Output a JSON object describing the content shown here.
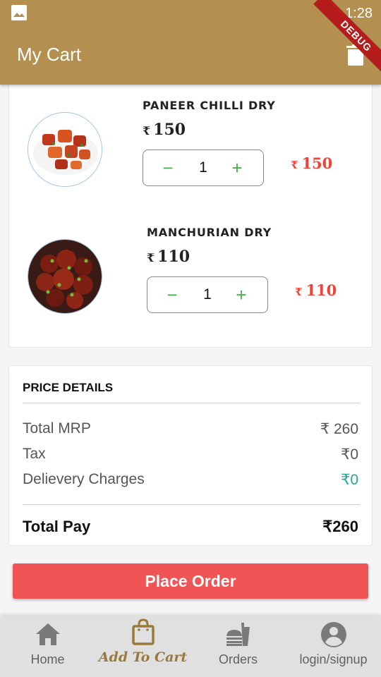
{
  "status_bar": {
    "time": "1:28"
  },
  "app_bar": {
    "title": "My Cart",
    "debug_label": "DEBUG"
  },
  "cart": {
    "currency": "₹",
    "items": [
      {
        "name": "PANEER CHILLI DRY",
        "price": "150",
        "quantity": "1",
        "total": "150",
        "image": "paneer-chilli-dry-photo"
      },
      {
        "name": "MANCHURIAN DRY",
        "price": "110",
        "quantity": "1",
        "total": "110",
        "image": "manchurian-dry-photo"
      }
    ],
    "minus_symbol": "−",
    "plus_symbol": "+"
  },
  "price_details": {
    "heading": "PRICE DETAILS",
    "rows": [
      {
        "label": "Total MRP",
        "value": "₹ 260"
      },
      {
        "label": "Tax",
        "value": "₹0"
      },
      {
        "label": "Delievery Charges",
        "value": "₹0"
      }
    ],
    "total_label": "Total Pay",
    "total_value": "₹260"
  },
  "place_order_label": "Place Order",
  "bottom_nav": {
    "items": [
      {
        "label": "Home",
        "icon": "home-icon"
      },
      {
        "label": "Add To Cart",
        "icon": "shopping-bag-icon",
        "active": true
      },
      {
        "label": "Orders",
        "icon": "fastfood-icon"
      },
      {
        "label": "login/signup",
        "icon": "account-circle-icon"
      }
    ]
  },
  "colors": {
    "app_bar": "#b38f50",
    "accent_red": "#f44336",
    "place_order": "#f05454",
    "stepper_green": "#4caf50",
    "delivery_green": "#26a69a",
    "nav_active": "#9a7a3c"
  }
}
